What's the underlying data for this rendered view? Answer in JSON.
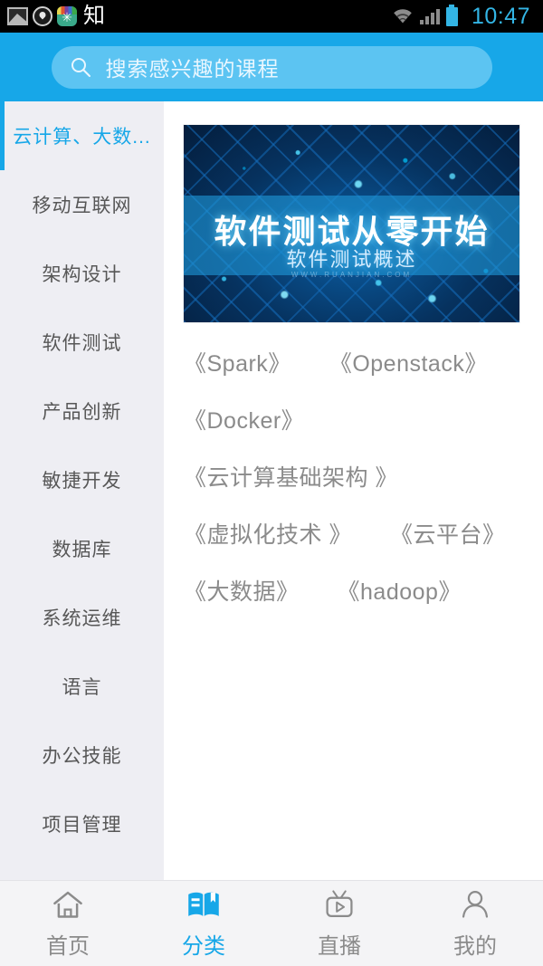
{
  "statusbar": {
    "icons": [
      "gallery-icon",
      "location-icon",
      "app-icon",
      "zhi-glyph",
      "wifi-icon",
      "signal-icon",
      "battery-icon"
    ],
    "app_glyph": "✳",
    "zhi_text": "知",
    "time": "10:47",
    "clock_color": "#33b5e5",
    "background": "#000000"
  },
  "header": {
    "background": "#17a7e8",
    "search": {
      "placeholder": "搜索感兴趣的课程",
      "icon": "search-icon",
      "background": "#5cc4f2"
    }
  },
  "sidebar": {
    "background": "#eeeef3",
    "active_color": "#17a7e8",
    "items": [
      {
        "label": "云计算、大数...",
        "active": true
      },
      {
        "label": "移动互联网",
        "active": false
      },
      {
        "label": "架构设计",
        "active": false
      },
      {
        "label": "软件测试",
        "active": false
      },
      {
        "label": "产品创新",
        "active": false
      },
      {
        "label": "敏捷开发",
        "active": false
      },
      {
        "label": "数据库",
        "active": false
      },
      {
        "label": "系统运维",
        "active": false
      },
      {
        "label": "语言",
        "active": false
      },
      {
        "label": "办公技能",
        "active": false
      },
      {
        "label": "项目管理",
        "active": false
      }
    ]
  },
  "main": {
    "banner": {
      "title": "软件测试从零开始",
      "subtitle": "软件测试概述",
      "brand": "WWW.RUANJIAN.COM",
      "alt": "course-banner-circuit-board"
    },
    "tag_rows": [
      {
        "tags": [
          "《Spark》",
          "《Openstack》"
        ]
      },
      {
        "tags": [
          "《Docker》"
        ]
      },
      {
        "tags": [
          "《云计算基础架构 》"
        ]
      },
      {
        "tags": [
          "《虚拟化技术 》",
          "《云平台》"
        ]
      },
      {
        "tags": [
          "《大数据》",
          "《hadoop》"
        ]
      }
    ]
  },
  "tabbar": {
    "background": "#f4f4f6",
    "active_color": "#17a7e8",
    "inactive_color": "#8b8b8b",
    "tabs": [
      {
        "label": "首页",
        "icon": "home-icon",
        "active": false
      },
      {
        "label": "分类",
        "icon": "book-category-icon",
        "active": true
      },
      {
        "label": "直播",
        "icon": "tv-live-icon",
        "active": false
      },
      {
        "label": "我的",
        "icon": "person-icon",
        "active": false
      }
    ]
  }
}
